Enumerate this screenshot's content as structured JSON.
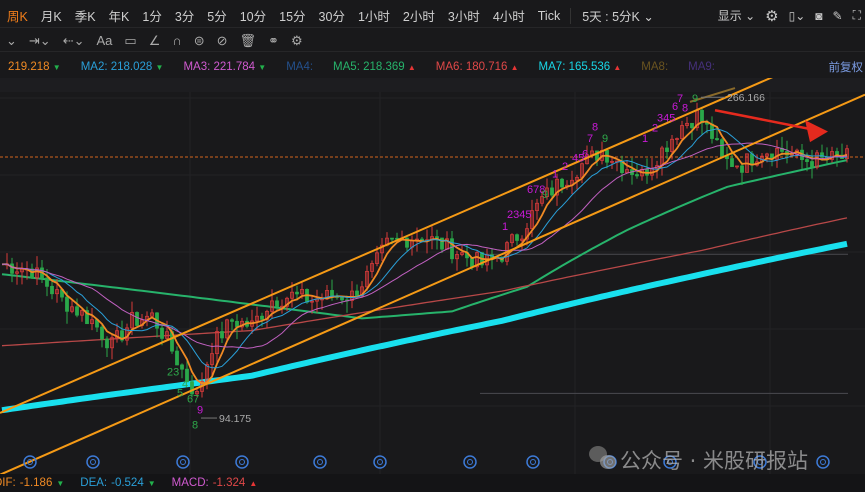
{
  "toolbar": {
    "periods": [
      "周K",
      "月K",
      "季K",
      "年K",
      "1分",
      "3分",
      "5分",
      "10分",
      "15分",
      "30分",
      "1小时",
      "2小时",
      "3小时",
      "4小时",
      "Tick"
    ],
    "active": "周K",
    "multi_day": "5天 : 5分K ⌄",
    "display": "显示 ⌄"
  },
  "drawbar": {
    "tools": [
      "⌄",
      "⇥⌄",
      "⇠⌄",
      "Aa",
      "▭",
      "∠",
      "∩",
      "⊜",
      "⊘",
      "🗑",
      "⚭",
      "⚙"
    ]
  },
  "ma": {
    "ma1": {
      "value": "219.218",
      "color": "#f08a24",
      "dir": "down"
    },
    "ma2": {
      "label": "MA2:",
      "value": "218.028",
      "color": "#2a9fd8",
      "dir": "down"
    },
    "ma3": {
      "label": "MA3:",
      "value": "221.784",
      "color": "#d05ad0",
      "dir": "down"
    },
    "ma4": {
      "label": "MA4:",
      "color": "#24508c"
    },
    "ma5": {
      "label": "MA5:",
      "value": "218.369",
      "color": "#27b36b",
      "dir": "up"
    },
    "ma6": {
      "label": "MA6:",
      "value": "180.716",
      "color": "#e04848",
      "dir": "up"
    },
    "ma7": {
      "label": "MA7:",
      "value": "165.536",
      "color": "#19d6e6",
      "dir": "up"
    },
    "ma8": {
      "label": "MA8:",
      "color": "#6a5420"
    },
    "ma9": {
      "label": "MA9:",
      "color": "#45307a"
    },
    "adjust": "前复权"
  },
  "chart_data": {
    "type": "candlestick",
    "scale": "log",
    "ylim": [
      94.175,
      266.166
    ],
    "high_label": "266.166",
    "low_label": "94.175",
    "last_price": 219.2,
    "closes_key": [
      [
        0,
        155
      ],
      [
        6,
        152
      ],
      [
        12,
        138
      ],
      [
        18,
        129
      ],
      [
        22,
        119
      ],
      [
        26,
        129
      ],
      [
        30,
        131
      ],
      [
        33,
        121
      ],
      [
        36,
        110
      ],
      [
        39,
        101
      ],
      [
        42,
        119
      ],
      [
        46,
        129
      ],
      [
        50,
        127
      ],
      [
        54,
        138
      ],
      [
        58,
        140
      ],
      [
        62,
        138
      ],
      [
        66,
        140
      ],
      [
        70,
        140
      ],
      [
        74,
        152
      ],
      [
        77,
        165
      ],
      [
        80,
        168
      ],
      [
        84,
        170
      ],
      [
        88,
        165
      ],
      [
        92,
        160
      ],
      [
        96,
        155
      ],
      [
        100,
        160
      ],
      [
        104,
        173
      ],
      [
        108,
        191
      ],
      [
        112,
        203
      ],
      [
        116,
        214
      ],
      [
        120,
        224
      ],
      [
        124,
        214
      ],
      [
        128,
        207
      ],
      [
        132,
        224
      ],
      [
        136,
        243
      ],
      [
        139,
        251
      ],
      [
        142,
        235
      ],
      [
        144,
        217
      ],
      [
        148,
        214
      ],
      [
        152,
        224
      ],
      [
        156,
        224
      ],
      [
        160,
        217
      ],
      [
        164,
        217
      ],
      [
        169,
        219
      ]
    ],
    "series": [
      {
        "name": "MA5",
        "color": "#27b36b",
        "width": 2,
        "points": [
          [
            0,
            150
          ],
          [
            25,
            143
          ],
          [
            50,
            136
          ],
          [
            72,
            130
          ],
          [
            90,
            133
          ],
          [
            105,
            144
          ],
          [
            125,
            173
          ],
          [
            145,
            199
          ],
          [
            169,
            217
          ]
        ]
      },
      {
        "name": "MA6",
        "color": "#b84848",
        "width": 1.3,
        "points": [
          [
            0,
            119
          ],
          [
            50,
            125
          ],
          [
            100,
            142
          ],
          [
            140,
            162
          ],
          [
            169,
            180
          ]
        ]
      },
      {
        "name": "MA7",
        "color": "#19e0ee",
        "width": 6,
        "points": [
          [
            0,
            96.6
          ],
          [
            50,
            108
          ],
          [
            100,
            129
          ],
          [
            140,
            150
          ],
          [
            169,
            165.5
          ]
        ]
      }
    ],
    "trendlines": [
      {
        "color": "#f59a16",
        "from": [
          0,
          96
        ],
        "to": [
          147,
          270
        ]
      },
      {
        "color": "#f59a16",
        "from": [
          11,
          85
        ],
        "to": [
          173,
          269
        ]
      }
    ],
    "td_labels": [
      {
        "i": 33,
        "p": 108,
        "t": "23",
        "c": "#2ea84a"
      },
      {
        "i": 36,
        "p": 104,
        "t": "4",
        "c": "#2ea84a"
      },
      {
        "i": 35,
        "p": 101,
        "t": "5",
        "c": "#2ea84a"
      },
      {
        "i": 37,
        "p": 99,
        "t": "67",
        "c": "#2ea84a"
      },
      {
        "i": 39,
        "p": 95.5,
        "t": "9",
        "c": "#c81ad6"
      },
      {
        "i": 38,
        "p": 91,
        "t": "8",
        "c": "#2ea84a"
      },
      {
        "i": 100,
        "p": 173,
        "t": "1",
        "c": "#c81ad6"
      },
      {
        "i": 101,
        "p": 180,
        "t": "2345",
        "c": "#c81ad6"
      },
      {
        "i": 105,
        "p": 195,
        "t": "678",
        "c": "#c81ad6"
      },
      {
        "i": 108,
        "p": 192,
        "t": "9",
        "c": "#2ea84a"
      },
      {
        "i": 110,
        "p": 205,
        "t": "1",
        "c": "#c81ad6"
      },
      {
        "i": 112,
        "p": 210,
        "t": "2",
        "c": "#c81ad6"
      },
      {
        "i": 114,
        "p": 216,
        "t": "45",
        "c": "#c81ad6"
      },
      {
        "i": 116,
        "p": 219,
        "t": "6",
        "c": "#c81ad6"
      },
      {
        "i": 117,
        "p": 230,
        "t": "7",
        "c": "#c81ad6"
      },
      {
        "i": 118,
        "p": 239,
        "t": "8",
        "c": "#c81ad6"
      },
      {
        "i": 120,
        "p": 230,
        "t": "9",
        "c": "#2ea84a"
      },
      {
        "i": 128,
        "p": 230,
        "t": "1",
        "c": "#c81ad6"
      },
      {
        "i": 130,
        "p": 238,
        "t": "2",
        "c": "#c81ad6"
      },
      {
        "i": 131,
        "p": 246,
        "t": "345",
        "c": "#c81ad6"
      },
      {
        "i": 134,
        "p": 255,
        "t": "6",
        "c": "#c81ad6"
      },
      {
        "i": 135,
        "p": 262,
        "t": "7",
        "c": "#c81ad6"
      },
      {
        "i": 136,
        "p": 254,
        "t": "8",
        "c": "#c81ad6"
      },
      {
        "i": 138,
        "p": 262,
        "t": "9",
        "c": "#2ea84a"
      }
    ]
  },
  "macd": {
    "dif_label": "DIF:",
    "dif": "-1.186",
    "dea_label": "DEA:",
    "dea": "-0.524",
    "macd_label": "MACD:",
    "macd": "-1.324"
  },
  "watermark": "公众号 · 米股研报站"
}
